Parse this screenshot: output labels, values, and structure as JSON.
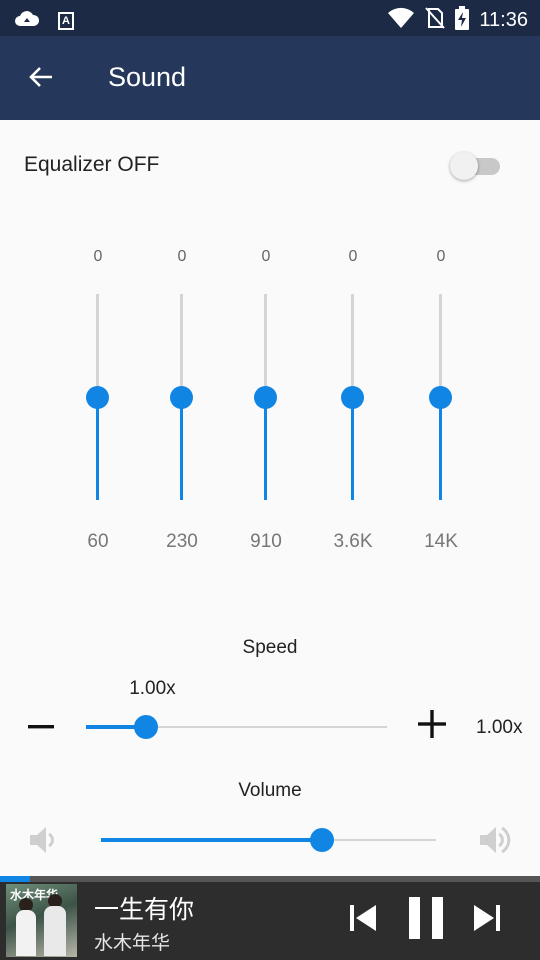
{
  "status_bar": {
    "time": "11:36",
    "icons": [
      "cloud-icon",
      "font-a-icon",
      "wifi-icon",
      "no-sim-icon",
      "battery-charging-icon"
    ]
  },
  "app_bar": {
    "title": "Sound",
    "back_icon": "arrow-back-icon"
  },
  "equalizer": {
    "label": "Equalizer OFF",
    "enabled": false,
    "bands": [
      {
        "gain": "0",
        "freq": "60",
        "level": 0.5
      },
      {
        "gain": "0",
        "freq": "230",
        "level": 0.5
      },
      {
        "gain": "0",
        "freq": "910",
        "level": 0.5
      },
      {
        "gain": "0",
        "freq": "3.6K",
        "level": 0.5
      },
      {
        "gain": "0",
        "freq": "14K",
        "level": 0.5
      }
    ]
  },
  "speed": {
    "label": "Speed",
    "bubble": "1.00x",
    "value": "1.00x",
    "level": 0.2,
    "minus_icon": "minus-icon",
    "plus_icon": "plus-icon"
  },
  "volume": {
    "label": "Volume",
    "level": 0.66,
    "low_icon": "volume-low-icon",
    "high_icon": "volume-high-icon"
  },
  "player": {
    "song_title": "一生有你",
    "artist": "水木年华",
    "album_art_text": "水木年华",
    "progress": 0.055,
    "controls": [
      "skip-previous-icon",
      "pause-icon",
      "skip-next-icon"
    ]
  },
  "colors": {
    "status_bar": "#1c2a45",
    "app_bar": "#25375a",
    "accent": "#1185e3",
    "player_bg": "#2d2d2d"
  }
}
